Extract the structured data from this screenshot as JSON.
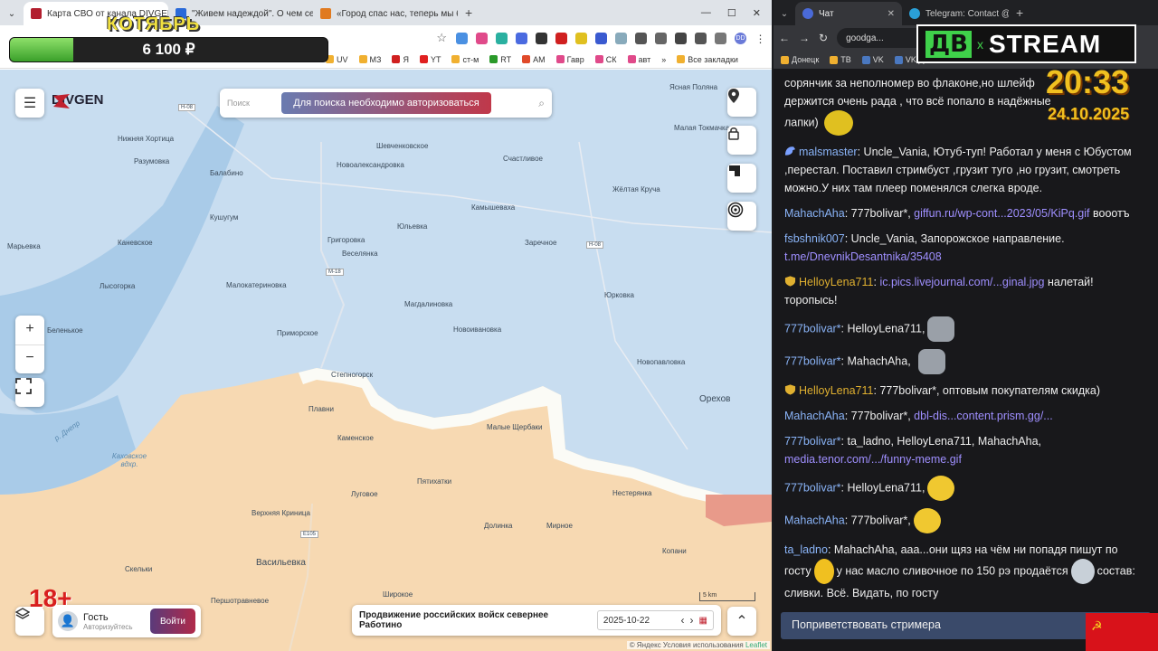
{
  "left_browser": {
    "tabs": [
      {
        "title": "Карта СВО от канала DIVGEN",
        "active": true
      },
      {
        "title": "\"Живем надеждой\". О чем сегодня",
        "active": false
      },
      {
        "title": "«Город спас нас, теперь мы б...",
        "active": false
      }
    ],
    "new_tab": "+",
    "url_prefix": "",
    "bookmarks": [
      "UV",
      "МЗ",
      "Я",
      "YT",
      "ст-м",
      "RT",
      "AM",
      "Гавр",
      "СК",
      "авт"
    ],
    "more_bookmarks": "»",
    "all_bookmarks": "Все закладки",
    "profile": "DD"
  },
  "right_browser": {
    "tabs": [
      {
        "title": "Чат",
        "active": true
      },
      {
        "title": "Telegram: Contact @D",
        "active": false
      }
    ],
    "url": "goodga...",
    "bookmarks": [
      "Донецк",
      "ТВ",
      "VK",
      "VK Д"
    ]
  },
  "map": {
    "brand": "DIVGEN",
    "search_placeholder": "Поиск",
    "auth_button": "Для поиска необходимо авторизоваться",
    "zoom_in": "+",
    "zoom_out": "−",
    "guest_name": "Гость",
    "guest_sub": "Авторизуйтесь",
    "login_button": "Войти",
    "bottom_title": "Продвижение российских войск севернее Работино",
    "date": "2025-10-22",
    "scale": "5 km",
    "attribution": "© Яндекс  Условия использования",
    "leaflet": "Leaflet",
    "places": {
      "p1": "Нижняя Хортица",
      "p2": "Разумовка",
      "p3": "Балабино",
      "p4": "Кушугум",
      "p5": "Каневское",
      "p6": "Лысогорка",
      "p7": "Беленькое",
      "p8": "Марьевка",
      "p9": "Шевченковское",
      "p10": "Новоалександровка",
      "p11": "Счастливое",
      "p12": "Камышеваха",
      "p13": "Жёлтая Круча",
      "p14": "Юльевка",
      "p15": "Григоровка",
      "p16": "Веселянка",
      "p17": "Заречное",
      "p18": "Малокатериновка",
      "p19": "Магдалиновка",
      "p20": "Юрковка",
      "p21": "Новоивановка",
      "p22": "Приморское",
      "p23": "Новопавловка",
      "p24": "Степногорск",
      "p25": "Плавни",
      "p26": "Каменское",
      "p27": "Малые Щербаки",
      "p28": "Орехов",
      "p29": "Пятихатки",
      "p30": "Луговое",
      "p31": "Нестерянка",
      "p32": "Верхняя Криница",
      "p33": "Долинка",
      "p34": "Мирное",
      "p35": "Скельки",
      "p36": "Васильевка",
      "p37": "Копани",
      "p38": "Широкое",
      "p39": "Першотравневое",
      "p40": "Каховское вдхр.",
      "p41": "р. Днепр",
      "p42": "Ясная Поляна",
      "p43": "Малая Токмачка"
    },
    "roads": [
      "Н-08",
      "М-18",
      "Е105",
      "Н-08"
    ]
  },
  "overlays": {
    "month_title": "КОТЯБРЬ",
    "goal_amount": "6 100 ₽",
    "goal_progress": 0.2,
    "age": "18+",
    "stream_db": "ДВ",
    "stream_x": "x",
    "stream_name": "STREAM",
    "clock": "20:33",
    "date": "24.10.2025"
  },
  "chat": {
    "messages": [
      {
        "user": "",
        "text": "сорянчик за неполномер во флаконе,но шлейф держится очень рада , что всё попало в надёжные лапки)",
        "user_color": "plain",
        "emote": "hearts"
      },
      {
        "user": "malsmaster",
        "text": "Uncle_Vania, Ютуб-туп! Работал у меня с Юбустом ,перестал. Поставил стримбуст ,грузит туго ,но грузит, смотреть можно.У них там плеер поменялся слегка вроде.",
        "user_color": "blue"
      },
      {
        "user": "MahachAha",
        "text": "777bolivar*,",
        "link": "giffun.ru/wp-cont...2023/05/KiPq.gif",
        "tail": "вооотъ",
        "user_color": "blue"
      },
      {
        "user": "fsbshnik007",
        "text": "Uncle_Vania, Запорожское направление.",
        "link": "t.me/DnevnikDesantnika/35408",
        "user_color": "blue"
      },
      {
        "user": "HelloyLena711",
        "text": "",
        "link": "ic.pics.livejournal.com/...ginal.jpg",
        "tail": "налетай! торопысь!",
        "user_color": "gold"
      },
      {
        "user": "777bolivar*",
        "text": "HelloyLena711,",
        "user_color": "blue",
        "emote": "cat"
      },
      {
        "user": "777bolivar*",
        "text": "MahachAha,",
        "user_color": "blue",
        "emote": "cat"
      },
      {
        "user": "HelloyLena711",
        "text": "777bolivar*, оптовым покупателям скидка)",
        "user_color": "gold"
      },
      {
        "user": "MahachAha",
        "text": "777bolivar*,",
        "link": "dbl-dis...content.prism.gg/...",
        "user_color": "blue"
      },
      {
        "user": "777bolivar*",
        "text": "ta_ladno, HelloyLena711, MahachAha,",
        "link": "media.tenor.com/.../funny-meme.gif",
        "user_color": "blue"
      },
      {
        "user": "777bolivar*",
        "text": "HelloyLena711,",
        "user_color": "blue",
        "emote": "smile"
      },
      {
        "user": "MahachAha",
        "text": "777bolivar*,",
        "user_color": "blue",
        "emote": "smile"
      },
      {
        "user": "ta_ladno",
        "text": "MahachAha, ааа...они щяз на чём ни попадя пишут по госту",
        "mid": "у нас масло сливочное по 150 рэ продаётся",
        "tail": "состав: сливки. Всё. Видать, по госту",
        "user_color": "blue"
      }
    ],
    "greet_button": "Поприветствовать стримера"
  }
}
